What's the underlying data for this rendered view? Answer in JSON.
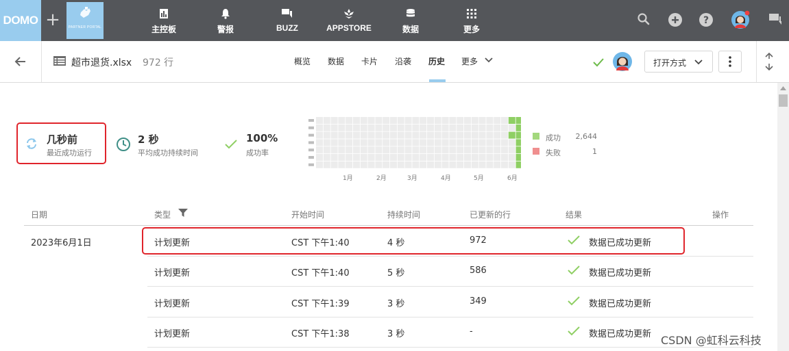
{
  "topnav": {
    "logo": "DOMO",
    "plus": "+",
    "partner_portal": "PARTNER PORTAL",
    "items": [
      {
        "label": "主控板",
        "icon": "dashboard-icon"
      },
      {
        "label": "警报",
        "icon": "bell-icon"
      },
      {
        "label": "BUZZ",
        "icon": "chat-icon"
      },
      {
        "label": "APPSTORE",
        "icon": "appstore-icon"
      },
      {
        "label": "数据",
        "icon": "database-icon"
      },
      {
        "label": "更多",
        "icon": "grid-icon"
      }
    ]
  },
  "subheader": {
    "dataset_name": "超市退货.xlsx",
    "row_count": "972 行",
    "tabs": [
      "概览",
      "数据",
      "卡片",
      "沿袭",
      "历史",
      "更多"
    ],
    "active_tab": "历史",
    "open_with": "打开方式"
  },
  "stats": {
    "last_run_value": "几秒前",
    "last_run_label": "最近成功运行",
    "duration_value": "2 秒",
    "duration_label": "平均成功持续时间",
    "success_value": "100%",
    "success_label": "成功率"
  },
  "heatmap": {
    "months": [
      "1月",
      "2月",
      "3月",
      "4月",
      "5月",
      "6月"
    ],
    "legend": [
      {
        "label": "成功",
        "count": "2,644",
        "color": "#a3d87d"
      },
      {
        "label": "失败",
        "count": "1",
        "color": "#f08f8f"
      }
    ],
    "colors": {
      "success": "#8fcf64",
      "empty": "#ececec"
    }
  },
  "table": {
    "headers": [
      "日期",
      "类型",
      "开始时间",
      "持续时间",
      "已更新的行",
      "结果",
      "操作"
    ],
    "date_group": "2023年6月1日",
    "rows": [
      {
        "type": "计划更新",
        "start": "CST 下午1:40",
        "duration": "4 秒",
        "rows": "972",
        "result": "数据已成功更新"
      },
      {
        "type": "计划更新",
        "start": "CST 下午1:40",
        "duration": "5 秒",
        "rows": "586",
        "result": "数据已成功更新"
      },
      {
        "type": "计划更新",
        "start": "CST 下午1:39",
        "duration": "3 秒",
        "rows": "349",
        "result": "数据已成功更新"
      },
      {
        "type": "计划更新",
        "start": "CST 下午1:38",
        "duration": "3 秒",
        "rows": "-",
        "result": "数据已成功更新"
      }
    ]
  },
  "watermark": "CSDN @虹科云科技"
}
